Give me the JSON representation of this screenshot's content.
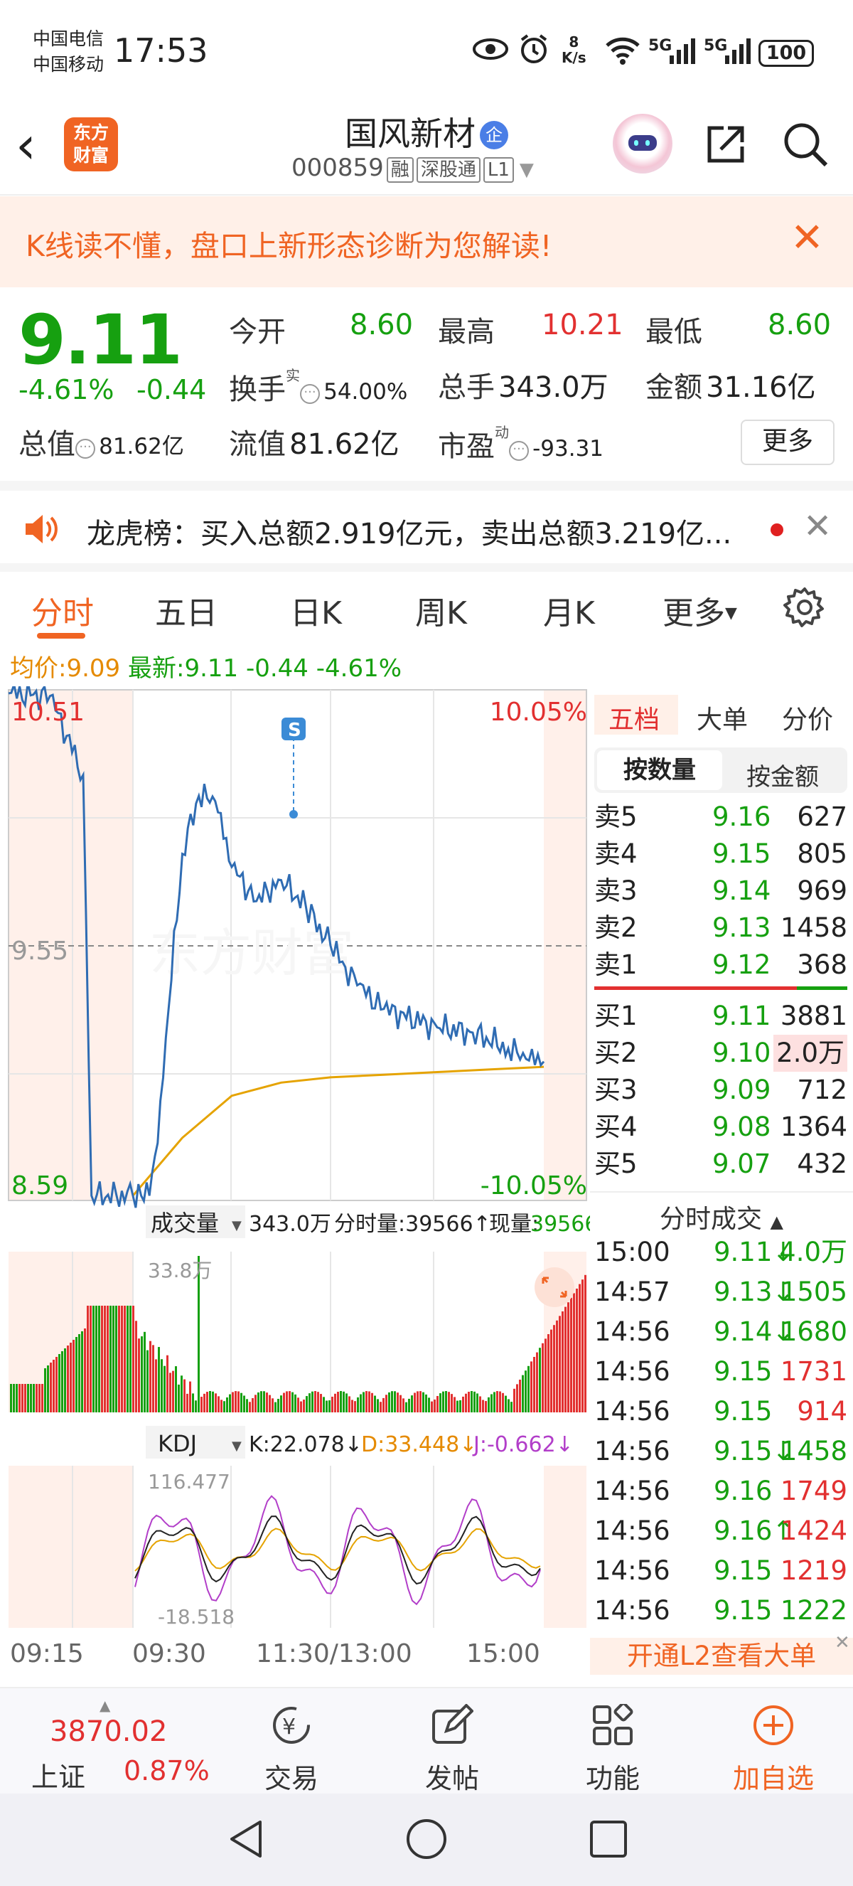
{
  "status": {
    "carrier1": "中国电信",
    "carrier2": "中国移动",
    "time": "17:53",
    "speed_top": "8",
    "speed_unit": "K/s",
    "sig1": "5G",
    "sig2": "5G",
    "battery": "100"
  },
  "header": {
    "logo_line1": "东方",
    "logo_line2": "财富",
    "name": "国风新材",
    "badge": "企",
    "code": "000859",
    "tags": [
      "融",
      "深股通",
      "L1"
    ]
  },
  "banner": {
    "text": "K线读不懂，盘口上新形态诊断为您解读!"
  },
  "quote": {
    "price": "9.11",
    "chg_pct": "-4.61%",
    "chg": "-0.44",
    "open_label": "今开",
    "open": "8.60",
    "high_label": "最高",
    "high": "10.21",
    "low_label": "最低",
    "low": "8.60",
    "turnover_label": "换手",
    "turnover_sup": "实",
    "turnover": "54.00%",
    "volume_label": "总手",
    "volume": "343.0万",
    "amount_label": "金额",
    "amount": "31.16亿",
    "mktcap_label": "总值",
    "mktcap": "81.62亿",
    "float_label": "流值",
    "float": "81.62亿",
    "pe_label": "市盈",
    "pe_sup": "动",
    "pe": "-93.31",
    "more": "更多"
  },
  "notice": {
    "text": "龙虎榜：买入总额2.919亿元，卖出总额3.219亿..."
  },
  "tabs": [
    "分时",
    "五日",
    "日K",
    "周K",
    "月K",
    "更多"
  ],
  "infoline": {
    "avg_label": "均价:",
    "avg": "9.09",
    "last_label": "最新:",
    "last": "9.11",
    "chg": "-0.44",
    "pct": "-4.61%"
  },
  "chart": {
    "price_max": "10.51",
    "price_mid": "9.55",
    "price_min": "8.59",
    "pct_max": "10.05%",
    "pct_min": "-10.05%",
    "signal": "S",
    "watermark": "东方财富",
    "vol_selector": "成交量",
    "vol_total": "343.0万",
    "vol_bar_label": "分时量:39566↑",
    "vol_now_label": "现量:",
    "vol_now": "39566",
    "vol_max": "33.8万",
    "kdj_selector": "KDJ",
    "kdj_k": "K:22.078↓",
    "kdj_d": "D:33.448↓",
    "kdj_j": "J:-0.662↓",
    "kdj_max": "116.477",
    "kdj_min": "-18.518",
    "time_labels": [
      "09:15",
      "09:30",
      "11:30/13:00",
      "15:00"
    ]
  },
  "chart_data": {
    "type": "line",
    "title": "",
    "y_range": [
      8.59,
      10.51
    ],
    "ref_price": 9.55,
    "series": [
      {
        "name": "",
        "x": [
          "09:15",
          "09:20",
          "09:24",
          "09:25",
          "09:30",
          "09:35",
          "09:40",
          "09:45",
          "09:50",
          "10:00",
          "10:10",
          "10:20",
          "10:30",
          "10:45",
          "11:00",
          "11:15",
          "11:30",
          "13:15",
          "13:30",
          "14:00",
          "14:20",
          "14:40",
          "14:50",
          "15:00"
        ],
        "values": [
          10.51,
          10.5,
          10.2,
          8.6,
          8.6,
          8.6,
          8.6,
          8.8,
          9.2,
          9.9,
          10.12,
          10.1,
          9.85,
          9.72,
          9.8,
          9.7,
          9.55,
          9.4,
          9.31,
          9.24,
          9.22,
          9.16,
          9.12,
          9.11
        ]
      },
      {
        "name": "均价",
        "x": [
          "09:30",
          "10:00",
          "10:30",
          "11:00",
          "11:30",
          "13:30",
          "14:00",
          "14:30",
          "15:00"
        ],
        "values": [
          8.6,
          8.82,
          8.98,
          9.03,
          9.05,
          9.06,
          9.07,
          9.08,
          9.09
        ]
      }
    ]
  },
  "book": {
    "tabs": [
      "五档",
      "大单",
      "分价"
    ],
    "subtabs": [
      "按数量",
      "按金额"
    ],
    "asks": [
      {
        "label": "卖5",
        "price": "9.16",
        "qty": "627"
      },
      {
        "label": "卖4",
        "price": "9.15",
        "qty": "805"
      },
      {
        "label": "卖3",
        "price": "9.14",
        "qty": "969"
      },
      {
        "label": "卖2",
        "price": "9.13",
        "qty": "1458"
      },
      {
        "label": "卖1",
        "price": "9.12",
        "qty": "368"
      }
    ],
    "bids": [
      {
        "label": "买1",
        "price": "9.11",
        "qty": "3881"
      },
      {
        "label": "买2",
        "price": "9.10",
        "qty": "2.0万"
      },
      {
        "label": "买3",
        "price": "9.09",
        "qty": "712"
      },
      {
        "label": "买4",
        "price": "9.08",
        "qty": "1364"
      },
      {
        "label": "买5",
        "price": "9.07",
        "qty": "432"
      }
    ],
    "trades_title": "分时成交",
    "trades": [
      {
        "time": "15:00",
        "price": "9.11↓",
        "vol": "4.0万",
        "c": "#16a010"
      },
      {
        "time": "14:57",
        "price": "9.13↓",
        "vol": "1505",
        "c": "#16a010"
      },
      {
        "time": "14:56",
        "price": "9.14↓",
        "vol": "1680",
        "c": "#16a010"
      },
      {
        "time": "14:56",
        "price": "9.15",
        "vol": "1731",
        "c": "#e23030",
        "pc": "#16a010"
      },
      {
        "time": "14:56",
        "price": "9.15",
        "vol": "914",
        "c": "#e23030",
        "pc": "#16a010"
      },
      {
        "time": "14:56",
        "price": "9.15↓",
        "vol": "1458",
        "c": "#16a010"
      },
      {
        "time": "14:56",
        "price": "9.16",
        "vol": "1749",
        "c": "#e23030",
        "pc": "#16a010"
      },
      {
        "time": "14:56",
        "price": "9.16↑",
        "vol": "1424",
        "c": "#e23030",
        "pc": "#16a010"
      },
      {
        "time": "14:56",
        "price": "9.15",
        "vol": "1219",
        "c": "#e23030",
        "pc": "#16a010"
      },
      {
        "time": "14:56",
        "price": "9.15",
        "vol": "1222",
        "c": "#16a010",
        "pc": "#16a010"
      }
    ],
    "l2": "开通L2查看大单"
  },
  "bottom": {
    "index_value": "3870.02",
    "index_name": "上证",
    "index_pct": "0.87%",
    "items": [
      "交易",
      "发帖",
      "功能",
      "加自选"
    ]
  },
  "colors": {
    "up": "#e23030",
    "down": "#16a010",
    "accent": "#f06423",
    "line": "#2f6cb3",
    "avg": "#e5a300"
  }
}
